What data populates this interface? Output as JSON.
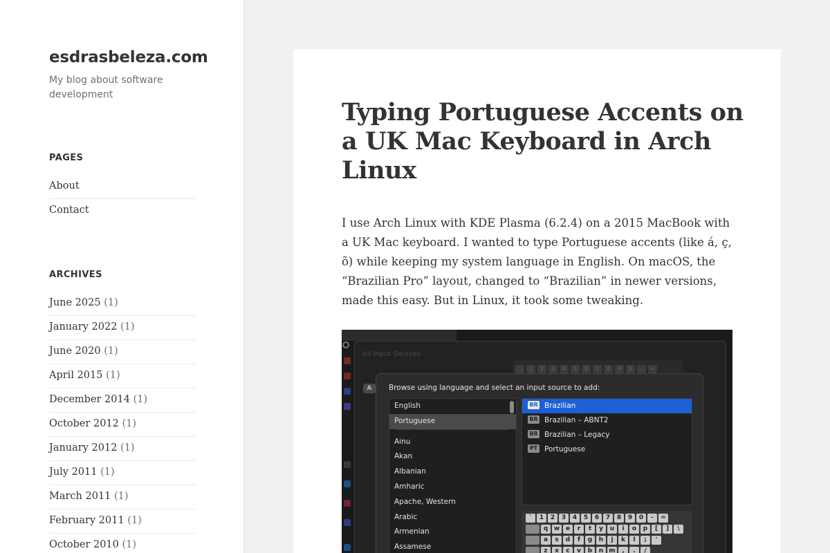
{
  "site": {
    "title": "esdrasbeleza.com",
    "description": "My blog about software development"
  },
  "pages_widget": {
    "title": "PAGES",
    "items": [
      {
        "label": "About"
      },
      {
        "label": "Contact"
      }
    ]
  },
  "archives_widget": {
    "title": "ARCHIVES",
    "items": [
      {
        "label": "June 2025",
        "count": "(1)"
      },
      {
        "label": "January 2022",
        "count": "(1)"
      },
      {
        "label": "June 2020",
        "count": "(1)"
      },
      {
        "label": "April 2015",
        "count": "(1)"
      },
      {
        "label": "December 2014",
        "count": "(1)"
      },
      {
        "label": "October 2012",
        "count": "(1)"
      },
      {
        "label": "January 2012",
        "count": "(1)"
      },
      {
        "label": "July 2011",
        "count": "(1)"
      },
      {
        "label": "March 2011",
        "count": "(1)"
      },
      {
        "label": "February 2011",
        "count": "(1)"
      },
      {
        "label": "October 2010",
        "count": "(1)"
      }
    ]
  },
  "post": {
    "title": "Typing Portuguese Accents on a UK Mac Keyboard in Arch Linux",
    "body": "I use Arch Linux with KDE Plasma (6.2.4) on a 2015 MacBook with a UK Mac keyboard. I wanted to type Portuguese accents (like á, ç, õ) while keeping my system language in English. On macOS, the “Brazilian Pro” layout, changed to “Brazilian” in newer versions, made this easy. But in Linux, it took some tweaking.",
    "screenshot": {
      "inputs_label": "All Input Sources",
      "a_badge": "A",
      "prompt": "Browse using language and select an input source to add:",
      "languages": [
        {
          "label": "English",
          "selected": false
        },
        {
          "label": "Portuguese",
          "selected": true
        },
        {
          "separator": true
        },
        {
          "label": "Ainu",
          "selected": false
        },
        {
          "label": "Akan",
          "selected": false
        },
        {
          "label": "Albanian",
          "selected": false
        },
        {
          "label": "Amharic",
          "selected": false
        },
        {
          "label": "Apache, Western",
          "selected": false
        },
        {
          "label": "Arabic",
          "selected": false
        },
        {
          "label": "Armenian",
          "selected": false
        },
        {
          "label": "Assamese",
          "selected": false
        }
      ],
      "sources": [
        {
          "badge": "BR",
          "label": "Brazilian",
          "selected": true
        },
        {
          "badge": "BR",
          "label": "Brazilian – ABNT2",
          "selected": false
        },
        {
          "badge": "BR",
          "label": "Brazilian – Legacy",
          "selected": false
        },
        {
          "badge": "PT",
          "label": "Portuguese",
          "selected": false
        }
      ],
      "top_keys": [
        "`",
        "1",
        "2",
        "3",
        "4",
        "5",
        "6",
        "7",
        "8",
        "9",
        "0",
        "-",
        "="
      ],
      "keyboard_rows": [
        [
          "`",
          "1",
          "2",
          "3",
          "4",
          "5",
          "6",
          "7",
          "8",
          "9",
          "0",
          "-",
          "="
        ],
        [
          "",
          "q",
          "w",
          "e",
          "r",
          "t",
          "y",
          "u",
          "i",
          "o",
          "p",
          "[",
          "]",
          "\\"
        ],
        [
          "",
          "a",
          "s",
          "d",
          "f",
          "g",
          "h",
          "j",
          "k",
          "l",
          ";",
          "'"
        ],
        [
          "",
          "z",
          "x",
          "c",
          "v",
          "b",
          "n",
          "m",
          ",",
          ".",
          "/"
        ]
      ],
      "colors": {
        "selection": "#1c5fd6",
        "dialog_bg": "#2c2c2c"
      }
    }
  }
}
